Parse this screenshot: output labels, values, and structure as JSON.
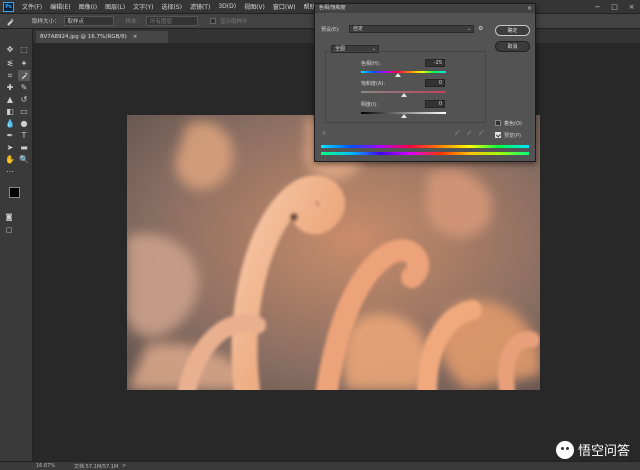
{
  "app": {
    "logo": "Ps",
    "menus": [
      "文件(F)",
      "编辑(E)",
      "图像(I)",
      "图层(L)",
      "文字(Y)",
      "选择(S)",
      "滤镜(T)",
      "3D(D)",
      "视图(V)",
      "窗口(W)",
      "帮助(H)"
    ],
    "window_controls": [
      "−",
      "□",
      "×"
    ]
  },
  "options": {
    "sample_size_label": "取样大小：",
    "sample_size_value": "取样点",
    "sample_label": "样本：",
    "sample_value": "所有图层",
    "show_ring_label": "显示取样环"
  },
  "document": {
    "tab_label": "8V7A8924.jpg @ 16.7%(RGB/8)",
    "close": "×"
  },
  "status": {
    "zoom": "16.67%",
    "doc_size": "文档:57.1M/57.1M",
    "arrow": ">"
  },
  "dialog": {
    "title": "色相/饱和度",
    "close": "×",
    "preset_label": "预设(E):",
    "preset_value": "自定",
    "ok": "确定",
    "cancel": "取消",
    "channel_value": "全图",
    "hue_label": "色相(H):",
    "hue_value": "-25",
    "saturation_label": "饱和度(A):",
    "saturation_value": "0",
    "lightness_label": "明度(I):",
    "lightness_value": "0",
    "colorize_label": "着色(O)",
    "preview_label": "预览(P)",
    "colorize_checked": false,
    "preview_checked": true,
    "hue_level": -25,
    "saturation_level": 0,
    "lightness_level": 0
  },
  "watermark": {
    "text": "悟空问答"
  },
  "colors": {
    "accent": "#31a8ff",
    "workspace": "#282828"
  }
}
